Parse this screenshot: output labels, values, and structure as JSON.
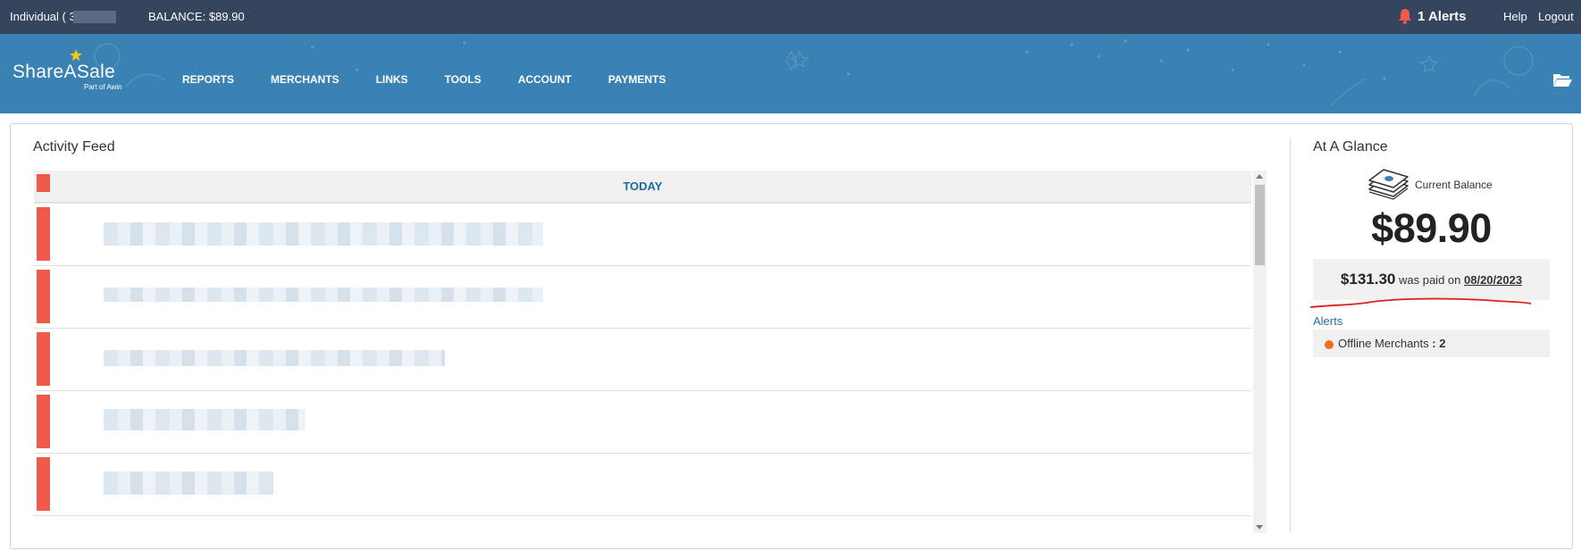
{
  "topbar": {
    "account_label": "Individual ( 3",
    "balance_label": "BALANCE: $89.90",
    "alerts_label": "1 Alerts",
    "help_label": "Help",
    "logout_label": "Logout"
  },
  "brand": {
    "name": "ShareASale",
    "tagline": "Part of Awin",
    "nav_color": "#3a82b4",
    "topbar_color": "#34455d"
  },
  "nav": {
    "items": [
      {
        "label": "REPORTS"
      },
      {
        "label": "MERCHANTS"
      },
      {
        "label": "LINKS"
      },
      {
        "label": "TOOLS"
      },
      {
        "label": "ACCOUNT"
      },
      {
        "label": "PAYMENTS"
      }
    ]
  },
  "activity_feed": {
    "title": "Activity Feed",
    "section_header": "TODAY",
    "row_marker_color": "#ef5a4b",
    "rows": [
      {
        "text": "[redacted]"
      },
      {
        "text": "[redacted]"
      },
      {
        "text": "[redacted]"
      },
      {
        "text": "[redacted]"
      },
      {
        "text": "[redacted]"
      }
    ]
  },
  "at_a_glance": {
    "title": "At A Glance",
    "current_balance_label": "Current Balance",
    "current_balance": "$89.90",
    "last_payment": {
      "amount": "$131.30",
      "text": "was paid on",
      "date": "08/20/2023"
    },
    "alerts_heading": "Alerts",
    "alerts": [
      {
        "label": "Offline Merchants",
        "separator": " : ",
        "count": "2"
      }
    ]
  },
  "icons": [
    "bell-icon",
    "star-icon",
    "folder-icon",
    "money-stack-icon",
    "alert-dot-icon"
  ]
}
